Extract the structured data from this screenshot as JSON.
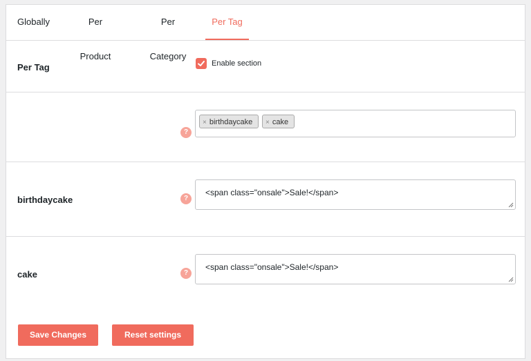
{
  "tabs": [
    {
      "label": "Globally"
    },
    {
      "label": "Per Product"
    },
    {
      "label": "Per Category"
    },
    {
      "label": "Per Tag",
      "active": true
    }
  ],
  "enable_row": {
    "label": "Per Tag",
    "checkbox_label": "Enable section",
    "checked": true
  },
  "tags_row": {
    "help": "?",
    "chips": [
      {
        "remove": "×",
        "label": "birthdaycake"
      },
      {
        "remove": "×",
        "label": "cake"
      }
    ]
  },
  "fields": [
    {
      "label": "birthdaycake",
      "value": "<span class=\"onsale\">Sale!</span>",
      "help": "?"
    },
    {
      "label": "cake",
      "value": "<span class=\"onsale\">Sale!</span>",
      "help": "?"
    }
  ],
  "buttons": {
    "save": "Save Changes",
    "reset": "Reset settings"
  },
  "colors": {
    "accent": "#f06b5d",
    "help": "#f7a499"
  }
}
